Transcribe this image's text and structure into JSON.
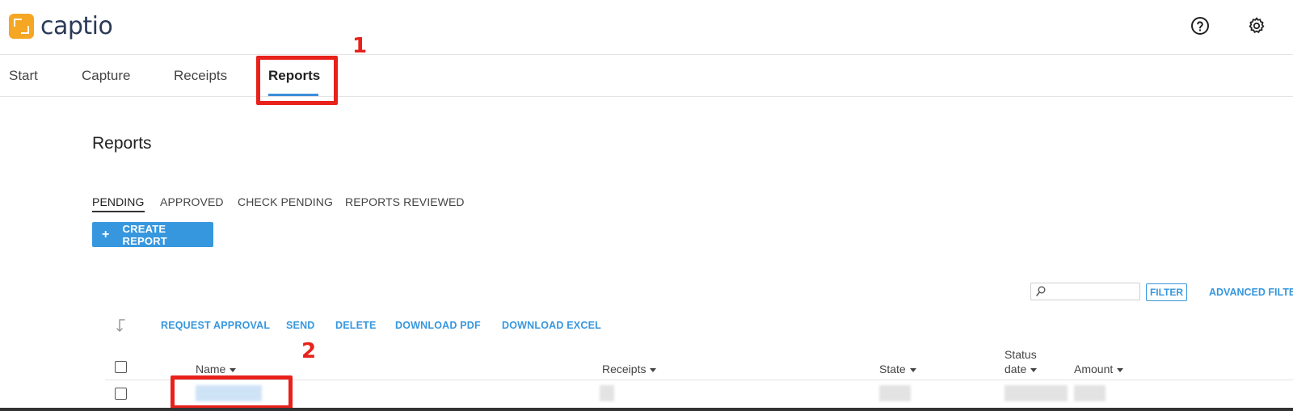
{
  "app": {
    "logo_text": "captio"
  },
  "header": {
    "help_icon": "help-circle-icon",
    "settings_icon": "gear-icon"
  },
  "nav": {
    "tabs": [
      "Start",
      "Capture",
      "Receipts",
      "Reports"
    ],
    "active": "Reports"
  },
  "annotations": {
    "first": "1",
    "second": "2",
    "color": "#e8211b"
  },
  "page": {
    "title": "Reports",
    "subtabs": [
      "PENDING",
      "APPROVED",
      "CHECK PENDING",
      "REPORTS REVIEWED"
    ],
    "active_subtab": "PENDING",
    "create_button": {
      "icon": "+",
      "label": "CREATE REPORT"
    }
  },
  "search": {
    "placeholder": "",
    "icon": "search-icon"
  },
  "filter": {
    "label": "FILTER",
    "advanced_label": "ADVANCED FILTE"
  },
  "actions": [
    "REQUEST APPROVAL",
    "SEND",
    "DELETE",
    "DOWNLOAD PDF",
    "DOWNLOAD EXCEL"
  ],
  "table": {
    "columns": {
      "name": "Name",
      "receipts": "Receipts",
      "state": "State",
      "status_date_line1": "Status",
      "status_date_line2": "date",
      "amount": "Amount"
    }
  },
  "colors": {
    "accent": "#3797de",
    "logo": "#f5a623",
    "tab_underline": "#3b8fd8"
  }
}
